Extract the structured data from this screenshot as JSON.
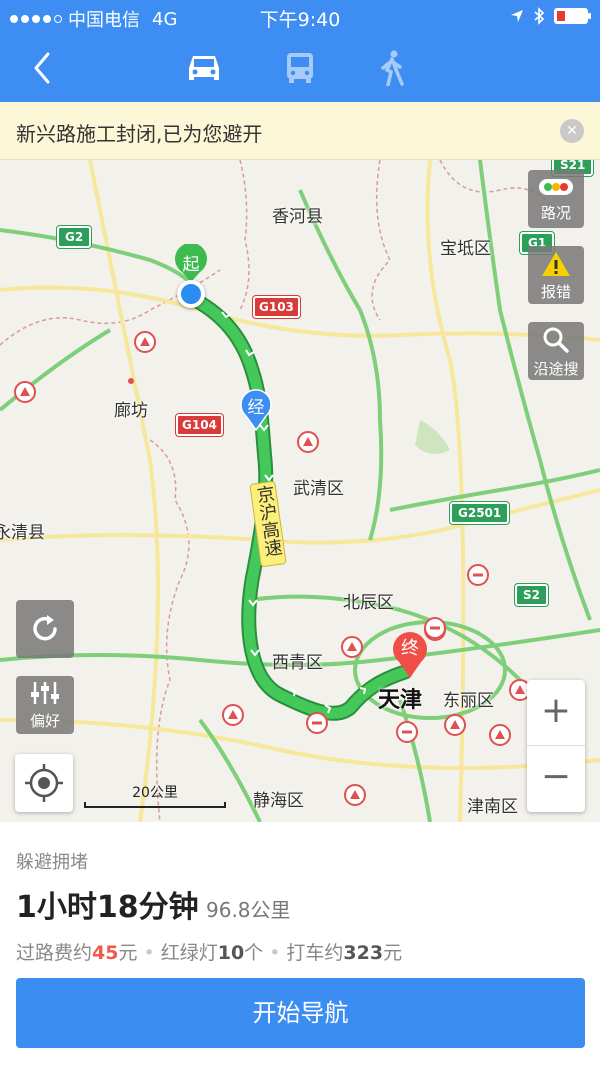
{
  "status_bar": {
    "carrier": "中国电信",
    "network": "4G",
    "time": "下午9:40"
  },
  "nav": {
    "modes": [
      {
        "icon": "car-icon",
        "active": true
      },
      {
        "icon": "bus-icon",
        "active": false
      },
      {
        "icon": "walk-icon",
        "active": false
      }
    ]
  },
  "notice": {
    "text": "新兴路施工封闭,已为您避开"
  },
  "map": {
    "places": {
      "xianghe": "香河县",
      "baodi": "宝坻区",
      "langfang": "廊坊",
      "wuqing": "武清区",
      "yongqing": "永清县",
      "beichen": "北辰区",
      "xiqing": "西青区",
      "tianjin": "天津",
      "dongli": "东丽区",
      "jinghai": "静海区",
      "jinnan": "津南区"
    },
    "highway_label": "京沪高速",
    "shields": {
      "g2": "G2",
      "g1": "G1",
      "s21": "S21",
      "g103": "G103",
      "g104": "G104",
      "g2501": "G2501",
      "s2": "S2"
    },
    "markers": {
      "start": "起",
      "via": "经",
      "end": "终"
    },
    "buttons": {
      "traffic": "路况",
      "report": "报错",
      "search_along": "沿途搜",
      "preference": "偏好",
      "zoom_in": "+",
      "zoom_out": "−"
    },
    "scale": "20公里",
    "colors": {
      "route": "#3bbf50",
      "route_border": "#2a8f3a",
      "header": "#3d8df2"
    }
  },
  "route": {
    "type": "躲避拥堵",
    "duration": "1小时18分钟",
    "distance": "96.8公里",
    "stats": {
      "toll_prefix": "过路费约",
      "toll_value": "45",
      "toll_unit": "元",
      "lights_prefix": "红绿灯",
      "lights_value": "10",
      "lights_unit": "个",
      "taxi_prefix": "打车约",
      "taxi_value": "323",
      "taxi_unit": "元"
    },
    "start_button": "开始导航"
  }
}
